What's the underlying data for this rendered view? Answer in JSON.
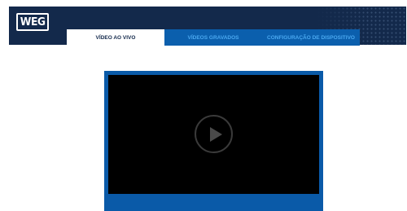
{
  "header": {
    "logo_text": "WEG",
    "background_color": "#13294b"
  },
  "tabs": [
    {
      "label": "VÍDEO AO VIVO",
      "active": true
    },
    {
      "label": "VÍDEOS GRAVADOS",
      "active": false
    },
    {
      "label": "CONFIGURAÇÃO DE DISPOSITIVO",
      "active": false
    }
  ],
  "player": {
    "frame_color": "#0a5aa8",
    "screen_color": "#000000",
    "play_icon": "play-circle-icon"
  }
}
